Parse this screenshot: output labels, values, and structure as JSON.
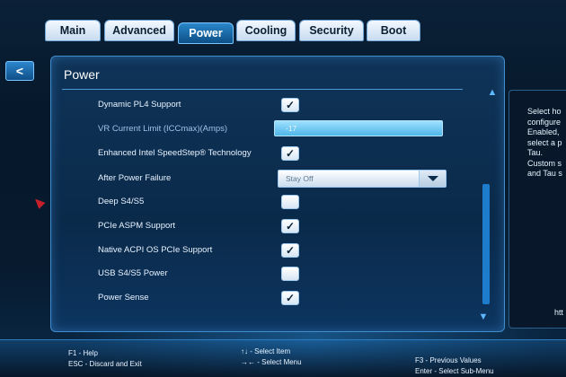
{
  "tabs": [
    "Main",
    "Advanced",
    "Power",
    "Cooling",
    "Security",
    "Boot"
  ],
  "back_label": "<",
  "panel": {
    "title": "Power",
    "rows": [
      {
        "label": "Dynamic PL4 Support",
        "control": "checkbox",
        "checked": true
      },
      {
        "label": "VR Current Limit (ICCmax)(Amps)",
        "control": "text",
        "value": "-17"
      },
      {
        "label": "Enhanced Intel SpeedStep® Technology",
        "control": "checkbox",
        "checked": true
      },
      {
        "label": "After Power Failure",
        "control": "select",
        "value": "Stay Off"
      },
      {
        "label": "Deep S4/S5",
        "control": "checkbox",
        "checked": false
      },
      {
        "label": "PCIe ASPM Support",
        "control": "checkbox",
        "checked": true
      },
      {
        "label": "Native ACPI OS PCIe Support",
        "control": "checkbox",
        "checked": true
      },
      {
        "label": "USB S4/S5 Power",
        "control": "checkbox",
        "checked": false
      },
      {
        "label": "Power Sense",
        "control": "checkbox",
        "checked": true
      }
    ]
  },
  "help": {
    "lines": [
      "Select ho",
      "configure",
      "Enabled,",
      "select a p",
      "Tau.",
      "Custom s",
      "and Tau s"
    ],
    "bottom": "htt"
  },
  "footer": {
    "f1": "F1 - Help",
    "esc": "ESC - Discard and Exit",
    "select_item": "↑↓ - Select Item",
    "select_menu": "→← - Select Menu",
    "f3": "F3 - Previous Values",
    "enter": "Enter - Select Sub-Menu"
  },
  "colors": {
    "accent": "#1d7ccc",
    "background": "#061424",
    "active_tab": "#1a6fb0"
  }
}
